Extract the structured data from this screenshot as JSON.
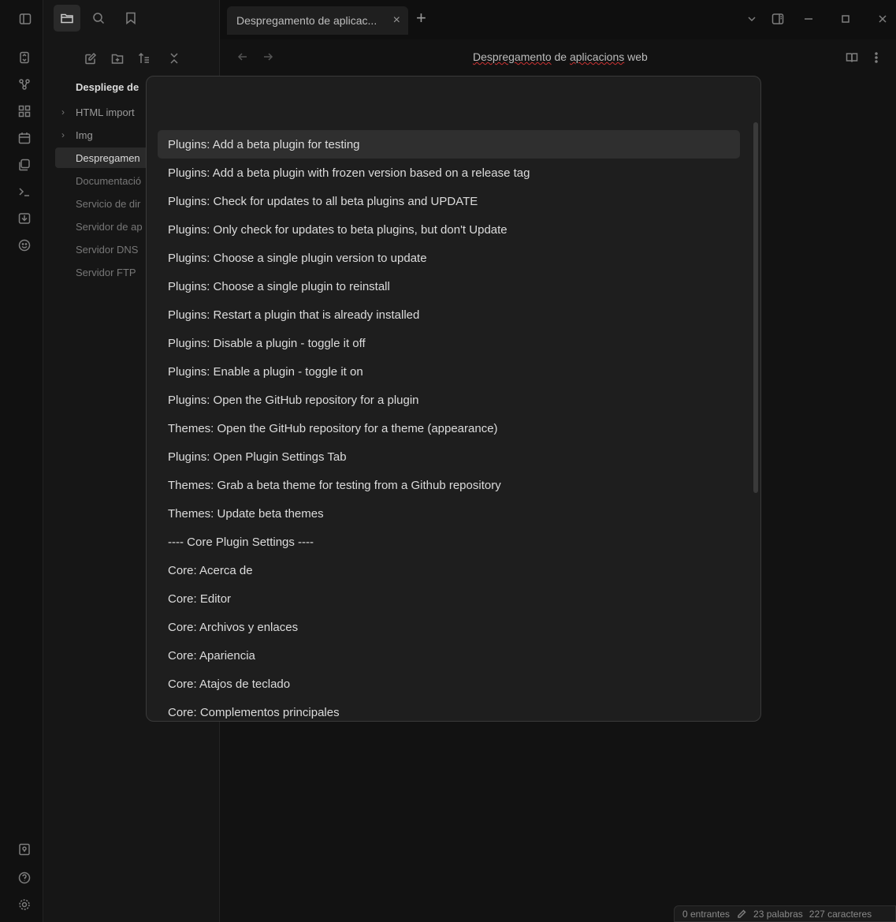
{
  "tab": {
    "title": "Despregamento de aplicac...",
    "close": "×",
    "new": "+"
  },
  "navbar": {
    "title_prefix": "Despregamento",
    "title_mid": " de ",
    "title_sp": "aplicacions",
    "title_suffix": " web"
  },
  "file_tree": {
    "vault_title": "Despliege de",
    "items": [
      {
        "label": "HTML import",
        "folder": true
      },
      {
        "label": "Img",
        "folder": true
      },
      {
        "label": "Despregamen",
        "active": true
      },
      {
        "label": "Documentació"
      },
      {
        "label": "Servicio de dir"
      },
      {
        "label": "Servidor de ap"
      },
      {
        "label": "Servidor DNS"
      },
      {
        "label": "Servidor FTP"
      }
    ]
  },
  "command_palette": {
    "input_value": "",
    "suggestions": [
      "Plugins: Add a beta plugin for testing",
      "Plugins: Add a beta plugin with frozen version based on a release tag",
      "Plugins: Check for updates to all beta plugins and UPDATE",
      "Plugins: Only check for updates to beta plugins, but don't Update",
      "Plugins: Choose a single plugin version to update",
      "Plugins: Choose a single plugin to reinstall",
      "Plugins: Restart a plugin that is already installed",
      "Plugins: Disable a plugin - toggle it off",
      "Plugins: Enable a plugin - toggle it on",
      "Plugins: Open the GitHub repository for a plugin",
      "Themes: Open the GitHub repository for a theme (appearance)",
      "Plugins: Open Plugin Settings Tab",
      "Themes: Grab a beta theme for testing from a Github repository",
      "Themes: Update beta themes",
      "---- Core Plugin Settings ----",
      "Core: Acerca de",
      "Core: Editor",
      "Core: Archivos y enlaces",
      "Core: Apariencia",
      "Core: Atajos de teclado",
      "Core: Complementos principales"
    ]
  },
  "statusbar": {
    "backlinks": "0 entrantes",
    "words": "23 palabras",
    "chars": "227 caracteres"
  }
}
